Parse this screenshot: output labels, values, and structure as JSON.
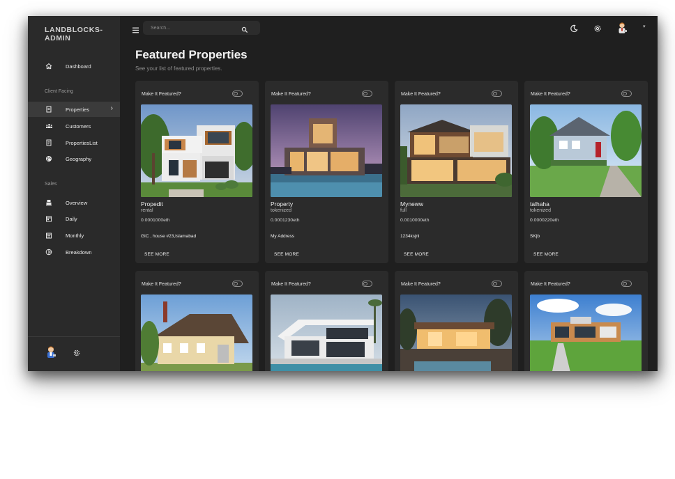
{
  "brand": {
    "line1": "LANDBLOCKS-",
    "line2": "ADMIN"
  },
  "sidebar": {
    "dashboard": "Dashboard",
    "section_client": "Client Facing",
    "client_items": [
      {
        "label": "Properties",
        "icon": "receipt-icon",
        "active": true
      },
      {
        "label": "Customers",
        "icon": "groups-icon"
      },
      {
        "label": "PropertiesList",
        "icon": "receipt-long-icon"
      },
      {
        "label": "Geography",
        "icon": "globe-icon"
      }
    ],
    "section_sales": "Sales",
    "sales_items": [
      {
        "label": "Overview",
        "icon": "point-of-sale-icon"
      },
      {
        "label": "Daily",
        "icon": "today-icon"
      },
      {
        "label": "Monthly",
        "icon": "calendar-month-icon"
      },
      {
        "label": "Breakdown",
        "icon": "pie-chart-icon"
      }
    ]
  },
  "topbar": {
    "search_placeholder": "Search..."
  },
  "page": {
    "title": "Featured Properties",
    "subtitle": "See your list of featured properties."
  },
  "cards": [
    {
      "featured_label": "Make It Featured?",
      "name": "Propedit",
      "type": "rental",
      "price": "0.0001000eth",
      "address": "GIC , house #23,Islamabad",
      "button": "SEE MORE"
    },
    {
      "featured_label": "Make It Featured?",
      "name": "Property",
      "type": "tokenized",
      "price": "0.0001230eth",
      "address": "My Address",
      "button": "SEE MORE"
    },
    {
      "featured_label": "Make It Featured?",
      "name": "Myneww",
      "type": "full",
      "price": "0.0010000eth",
      "address": "1234ksjnl",
      "button": "SEE MORE"
    },
    {
      "featured_label": "Make It Featured?",
      "name": "talhaha",
      "type": "tokenized",
      "price": "0.0000220eth",
      "address": "SK|b",
      "button": "SEE MORE"
    },
    {
      "featured_label": "Make It Featured?"
    },
    {
      "featured_label": "Make It Featured?"
    },
    {
      "featured_label": "Make It Featured?"
    },
    {
      "featured_label": "Make It Featured?"
    }
  ],
  "colors": {
    "background": "#1f1f1f",
    "sidebar": "#2a2a2a",
    "card": "#2b2b2b",
    "active_nav": "#3b3b3b"
  }
}
